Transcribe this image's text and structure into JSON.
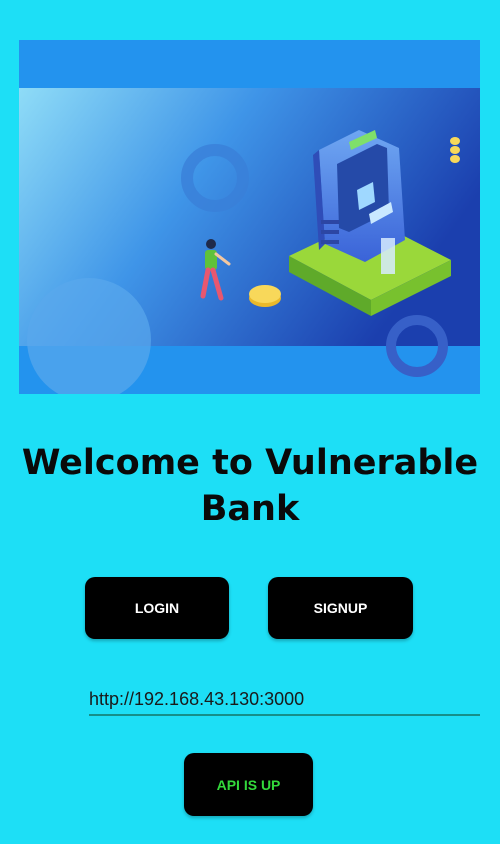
{
  "hero": {
    "image": "atm-isometric-illustration"
  },
  "welcome_title": "Welcome to Vulnerable Bank",
  "buttons": {
    "login_label": "LOGIN",
    "signup_label": "SIGNUP",
    "api_status_label": "API IS UP"
  },
  "server_url": {
    "value": "http://192.168.43.130:3000"
  },
  "colors": {
    "background": "#1ddff6",
    "button": "#000000",
    "api_status_text": "#33d93b",
    "underline": "#168f8a"
  }
}
